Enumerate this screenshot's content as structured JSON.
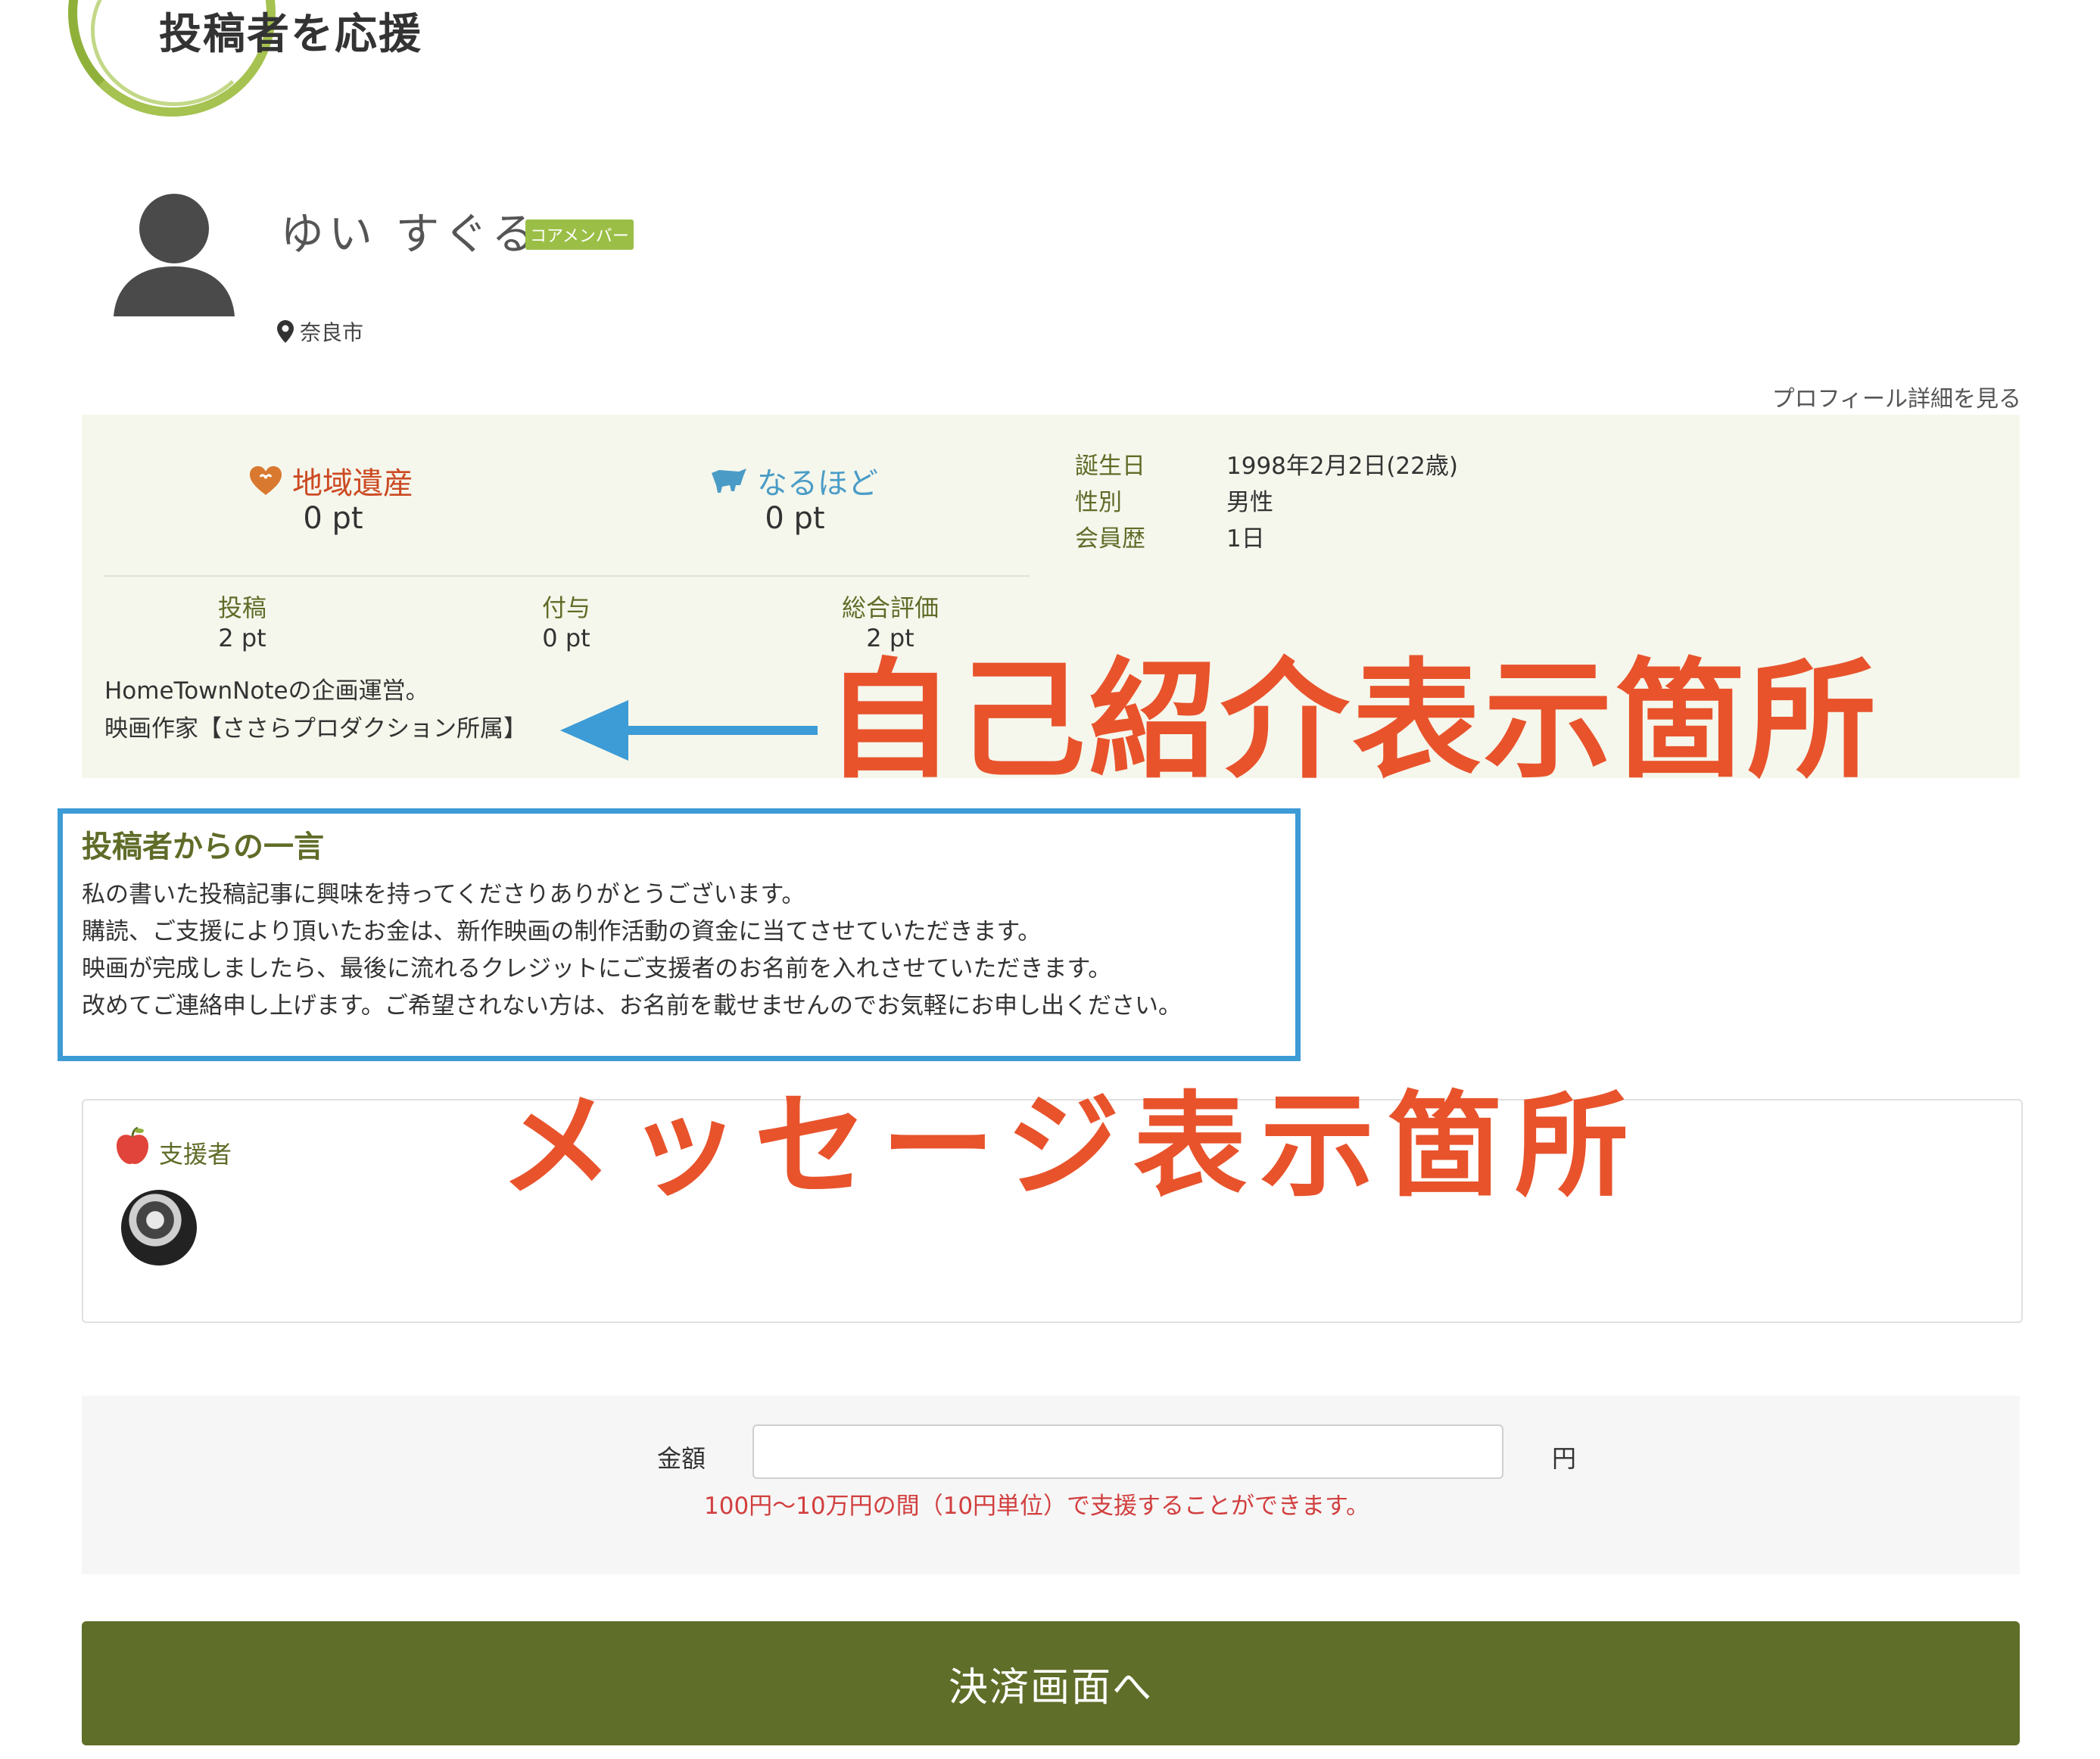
{
  "header": {
    "title": "投稿者を応援"
  },
  "profile": {
    "name": "ゆい すぐる",
    "badge": "コアメンバー",
    "location": "奈良市",
    "detail_link": "プロフィール詳細を見る"
  },
  "points": {
    "heritage": {
      "label": "地域遺産",
      "value": "0 pt",
      "color": "#cc4a23"
    },
    "naruhodo": {
      "label": "なるほど",
      "value": "0 pt",
      "color": "#4a9cc7"
    }
  },
  "stats": [
    {
      "label": "投稿",
      "value": "2 pt"
    },
    {
      "label": "付与",
      "value": "0 pt"
    },
    {
      "label": "総合評価",
      "value": "2 pt"
    }
  ],
  "info": [
    {
      "label": "誕生日",
      "value": "1998年2月2日(22歳)"
    },
    {
      "label": "性別",
      "value": "男性"
    },
    {
      "label": "会員歴",
      "value": "1日"
    }
  ],
  "bio": {
    "line1": "HomeTownNoteの企画運営。",
    "line2": "映画作家【ささらプロダクション所属】"
  },
  "annotations": {
    "intro": "自己紹介表示箇所",
    "message": "メッセージ表示箇所",
    "color": "#e8532c"
  },
  "message": {
    "title": "投稿者からの一言",
    "lines": [
      "私の書いた投稿記事に興味を持ってくださりありがとうございます。",
      "購読、ご支援により頂いたお金は、新作映画の制作活動の資金に当てさせていただきます。",
      "映画が完成しましたら、最後に流れるクレジットにご支援者のお名前を入れさせていただきます。",
      "改めてご連絡申し上げます。ご希望されない方は、お名前を載せませんのでお気軽にお申し出ください。"
    ]
  },
  "supporters": {
    "label": "支援者"
  },
  "payment": {
    "amount_label": "金額",
    "amount_value": "",
    "unit": "円",
    "note": "100円〜10万円の間（10円単位）で支援することができます。",
    "button": "決済画面へ"
  }
}
